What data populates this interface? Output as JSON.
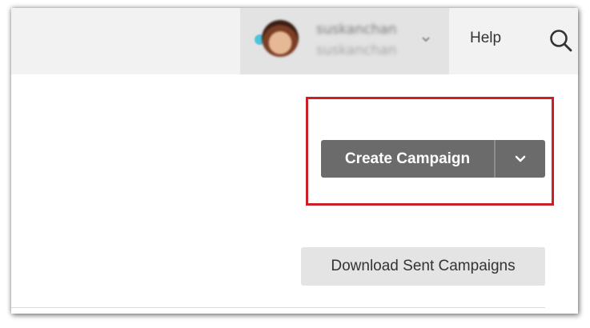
{
  "header": {
    "user": {
      "name": "suskanchan",
      "handle": "suskanchan",
      "status_color": "#4fc3dd"
    },
    "help_label": "Help",
    "search_icon": "search-icon"
  },
  "main": {
    "create_campaign_label": "Create Campaign",
    "dropdown_icon": "chevron-down-icon",
    "download_label": "Download Sent Campaigns"
  },
  "colors": {
    "highlight_border": "#cc1f25",
    "primary_button": "#6b6b6b",
    "secondary_button": "#e4e4e4",
    "topbar": "#f2f2f2"
  }
}
